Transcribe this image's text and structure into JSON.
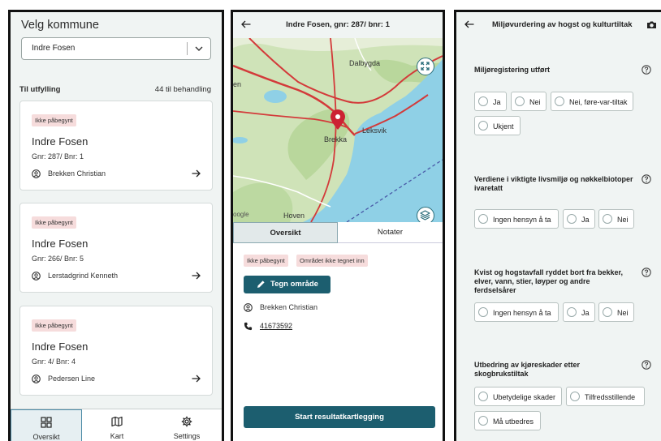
{
  "panel1": {
    "title": "Velg kommune",
    "select": {
      "value": "Indre Fosen"
    },
    "section_label": "Til utfylling",
    "count_label": "44 til behandling",
    "cards": [
      {
        "badge": "Ikke påbegynt",
        "name": "Indre Fosen",
        "gnr": "Gnr: 287/ Bnr: 1",
        "owner": "Brekken Christian"
      },
      {
        "badge": "Ikke påbegynt",
        "name": "Indre Fosen",
        "gnr": "Gnr: 266/ Bnr: 5",
        "owner": "Lerstadgrind Kenneth"
      },
      {
        "badge": "Ikke påbegynt",
        "name": "Indre Fosen",
        "gnr": "Gnr: 4/ Bnr: 4",
        "owner": "Pedersen Line"
      }
    ],
    "nav": [
      {
        "label": "Oversikt",
        "icon": "grid-icon",
        "active": true
      },
      {
        "label": "Kart",
        "icon": "map-icon",
        "active": false
      },
      {
        "label": "Settings",
        "icon": "gear-icon",
        "active": false
      }
    ]
  },
  "panel2": {
    "title": "Indre Fosen, gnr: 287/ bnr: 1",
    "map": {
      "labels": {
        "dalbygda": "Dalbygda",
        "leksvik": "Leksvik",
        "brekka": "Brekka",
        "hoven": "Hoven",
        "en": "en",
        "google": "oogle"
      },
      "colors": {
        "land": "#cfe3b8",
        "water": "#8fd0e6",
        "road": "#d33a3a",
        "pin": "#cc2233"
      }
    },
    "tabs": [
      {
        "label": "Oversikt",
        "active": true
      },
      {
        "label": "Notater",
        "active": false
      }
    ],
    "badges": [
      "Ikke påbegynt",
      "Området ikke tegnet inn"
    ],
    "draw_button": "Tegn område",
    "owner": "Brekken Christian",
    "phone": "41673592",
    "start_button": "Start resultatkartlegging",
    "colors": {
      "primary": "#1c5e6f",
      "badge_bg": "#f6dcdc"
    }
  },
  "panel3": {
    "title": "Miljøvurdering av hogst og kulturtiltak",
    "questions": [
      {
        "label": "Miljøregistering utført",
        "options": [
          "Ja",
          "Nei",
          "Nei, føre-var-tiltak",
          "Ukjent"
        ]
      },
      {
        "label": "Verdiene i viktigte livsmiljø og nøkkelbiotoper ivaretatt",
        "options": [
          "Ingen hensyn å ta",
          "Ja",
          "Nei"
        ]
      },
      {
        "label": "Kvist og hogstavfall ryddet bort fra bekker, elver, vann, stier, løyper og andre ferdselsårer",
        "options": [
          "Ingen hensyn å ta",
          "Ja",
          "Nei"
        ]
      },
      {
        "label": "Utbedring av kjøreskader etter skogbrukstiltak",
        "options": [
          "Ubetydelige skader",
          "Tilfredsstillende",
          "Må utbedres"
        ]
      }
    ]
  }
}
